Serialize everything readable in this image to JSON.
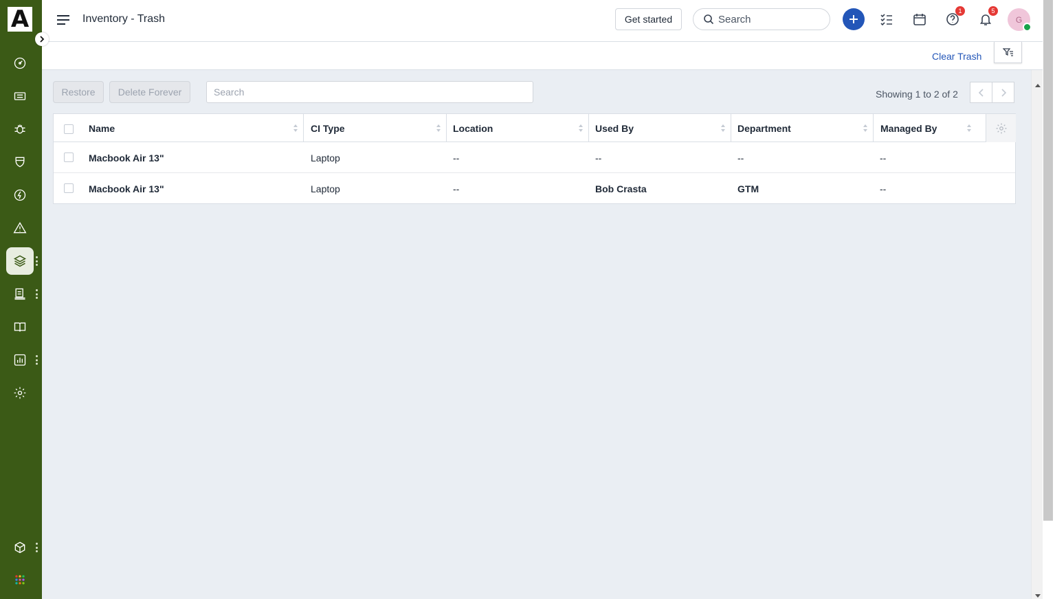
{
  "app": {
    "logo_letter": "A"
  },
  "header": {
    "title": "Inventory - Trash",
    "get_started_label": "Get started",
    "search_label": "Search",
    "help_badge": "1",
    "notifications_badge": "5",
    "avatar_initial": "G"
  },
  "subbar": {
    "clear_trash_label": "Clear Trash"
  },
  "toolbar": {
    "restore_label": "Restore",
    "delete_forever_label": "Delete Forever",
    "search_placeholder": "Search",
    "showing_text": "Showing 1 to 2 of 2"
  },
  "table": {
    "columns": [
      "Name",
      "CI Type",
      "Location",
      "Used By",
      "Department",
      "Managed By"
    ],
    "rows": [
      {
        "name": "Macbook Air 13\"",
        "ci_type": "Laptop",
        "location": "--",
        "used_by": "--",
        "department": "--",
        "managed_by": "--"
      },
      {
        "name": "Macbook Air 13\"",
        "ci_type": "Laptop",
        "location": "--",
        "used_by": "Bob Crasta",
        "department": "GTM",
        "managed_by": "--"
      }
    ]
  },
  "colors": {
    "sidebar_bg": "#3b5a16",
    "accent": "#2356b8",
    "badge": "#e53935"
  }
}
